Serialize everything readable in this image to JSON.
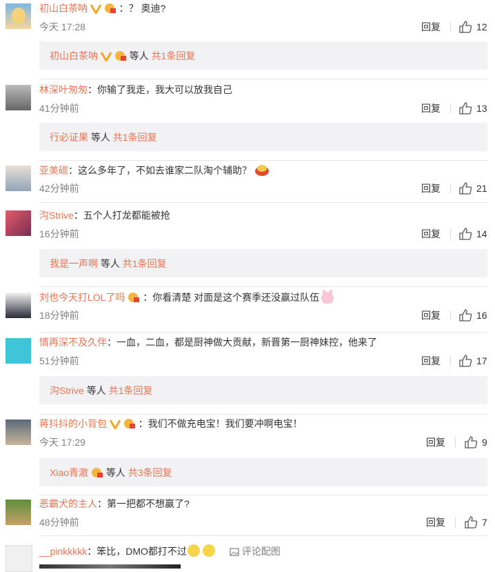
{
  "common": {
    "reply_label": "回复",
    "and_others": "等人"
  },
  "comments": [
    {
      "name": "初山白茶呐",
      "text": "：？ 奥迪?",
      "time": "今天 17:28",
      "likes": "12",
      "sub": {
        "name": "初山白茶呐",
        "count": "共1条回复"
      }
    },
    {
      "name": "林深叶匆匆",
      "text": "：你输了我走，我大可以放我自己",
      "time": "41分钟前",
      "likes": "13",
      "sub": {
        "name": "行必证果",
        "count": "共1条回复"
      }
    },
    {
      "name": "亚美碳",
      "text": "：这么多年了，不如去谁家二队淘个辅助？",
      "time": "42分钟前",
      "likes": "21"
    },
    {
      "name": "沟Strive",
      "text": "：五个人打龙都能被抢",
      "time": "16分钟前",
      "likes": "14",
      "sub": {
        "name": "我是一声啊",
        "count": "共1条回复"
      }
    },
    {
      "name": "刘也今天打LOL了吗",
      "text": "：你看清楚 对面是这个赛季还没赢过队伍",
      "time": "18分钟前",
      "likes": "16"
    },
    {
      "name": "情再深不及久伴",
      "text": "：一血，二血，都是厨神做大贡献，新晋第一厨神妹控，他来了",
      "time": "51分钟前",
      "likes": "17",
      "sub": {
        "name": "沟Strive",
        "count": "共1条回复"
      }
    },
    {
      "name": "蒋抖抖的小背包",
      "text": "：我们不做充电宝！我们要冲啊电宝！",
      "time": "今天 17:29",
      "likes": "9",
      "sub": {
        "name": "Xiao青澈",
        "count": "共3条回复"
      }
    },
    {
      "name": "恶霸犬的主人",
      "text": "：第一把都不想赢了?",
      "time": "48分钟前",
      "likes": "7"
    },
    {
      "name": "__pinkkkkk",
      "text": "：笨比，DMO都打不过",
      "pic_label": "评论配图"
    }
  ]
}
